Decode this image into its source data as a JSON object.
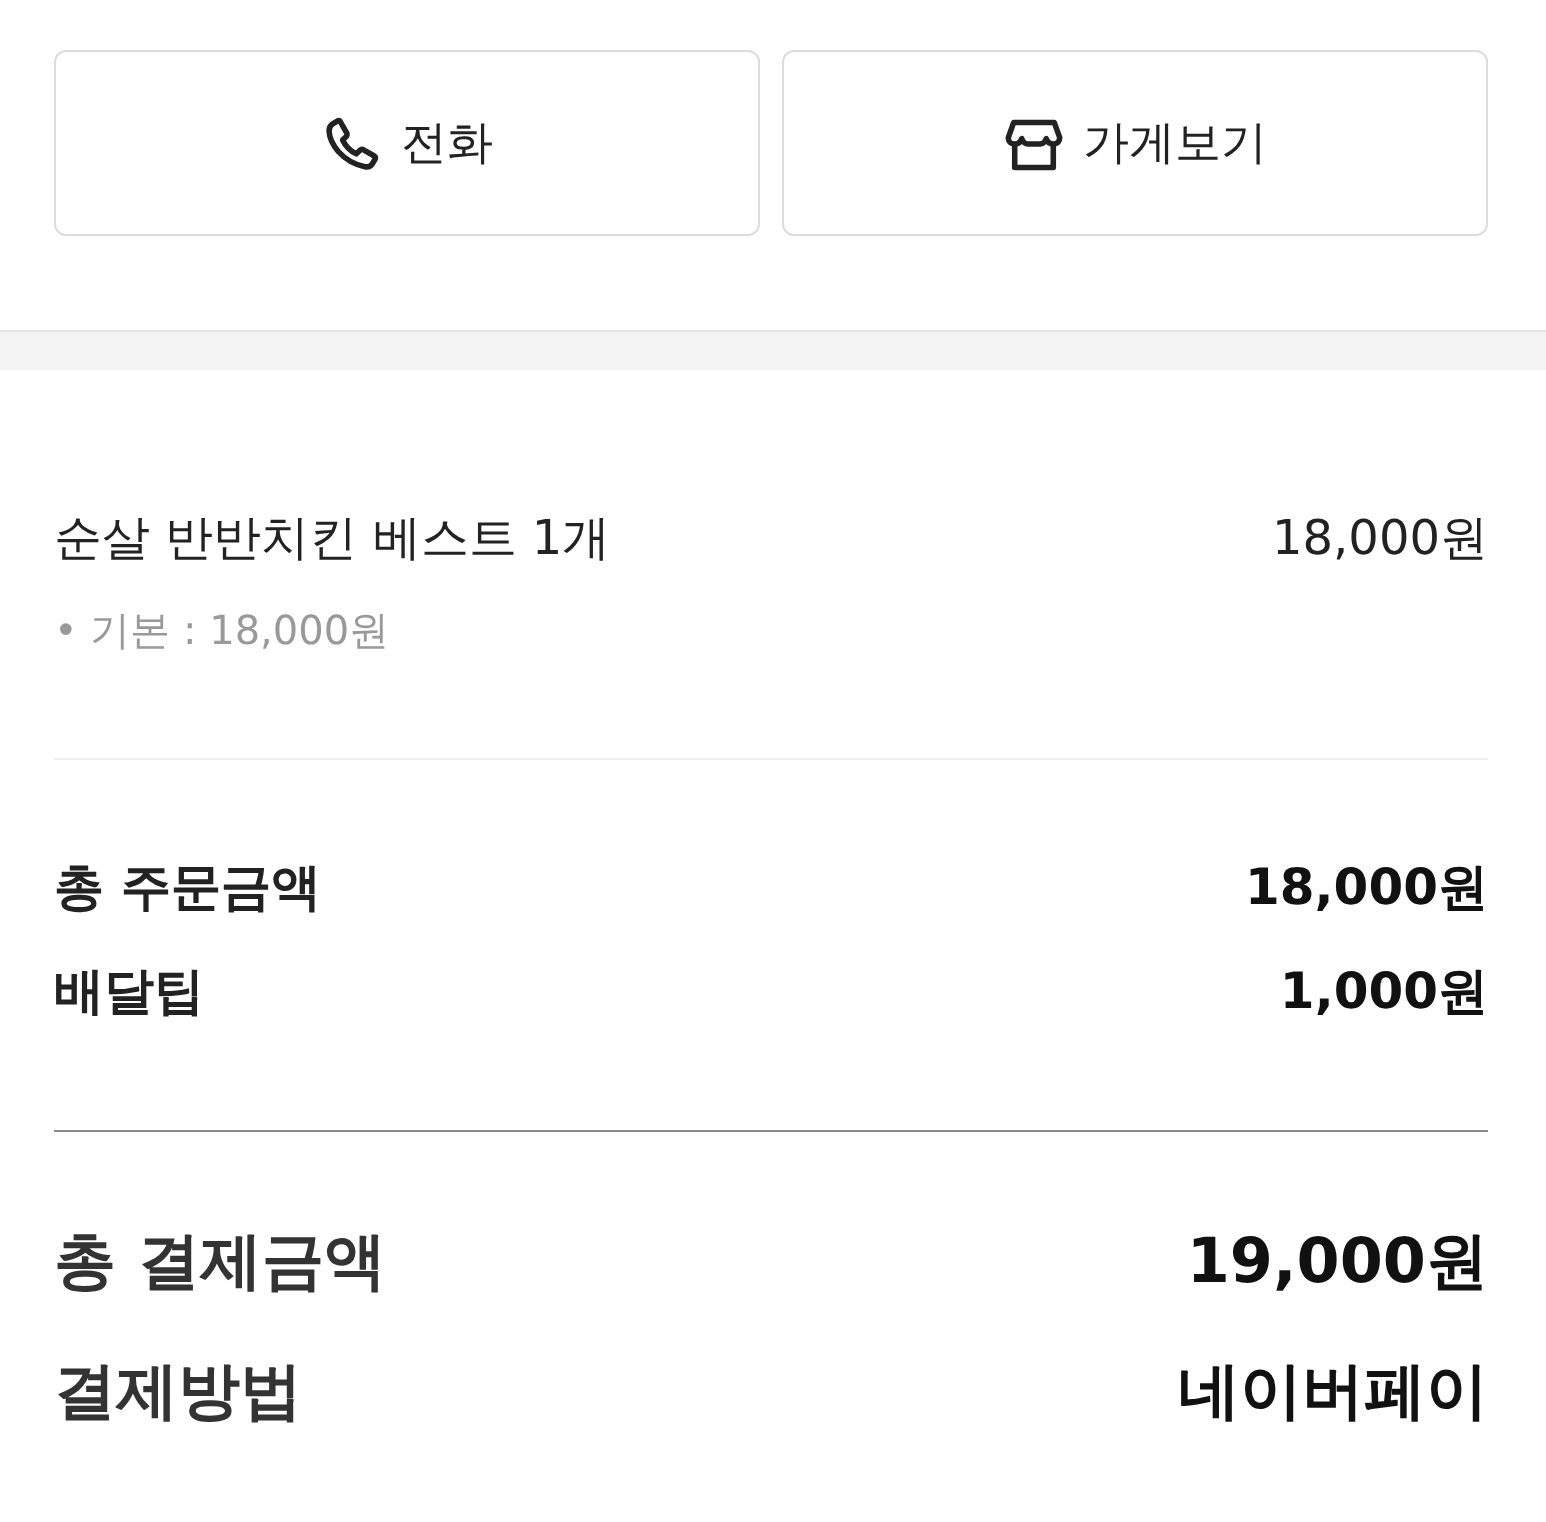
{
  "action_buttons": [
    {
      "kind": "phone",
      "label": "전화"
    },
    {
      "kind": "store",
      "label": "가게보기"
    }
  ],
  "order_items": [
    {
      "name": "순살 반반치킨 베스트 1개",
      "price": "18,000원",
      "options": [
        "• 기본 : 18,000원"
      ]
    }
  ],
  "summary": [
    {
      "label": "총 주문금액",
      "value": "18,000원"
    },
    {
      "label": "배달팁",
      "value": "1,000원"
    }
  ],
  "payment": [
    {
      "label": "총 결제금액",
      "value": "19,000원"
    },
    {
      "label": "결제방법",
      "value": "네이버페이"
    }
  ]
}
